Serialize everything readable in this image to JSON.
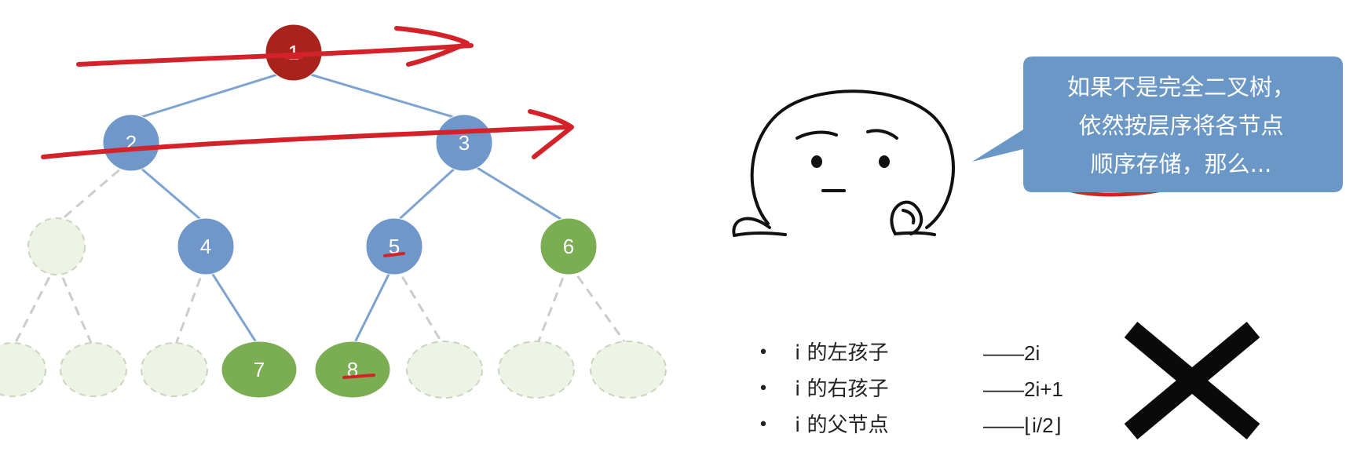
{
  "tree": {
    "nodes": [
      {
        "id": "1",
        "label": "1",
        "level": 0,
        "status": "root"
      },
      {
        "id": "2",
        "label": "2",
        "level": 1,
        "status": "stored"
      },
      {
        "id": "3",
        "label": "3",
        "level": 1,
        "status": "stored"
      },
      {
        "id": "g2l",
        "label": "",
        "level": 2,
        "status": "ghost"
      },
      {
        "id": "4",
        "label": "4",
        "level": 2,
        "status": "stored"
      },
      {
        "id": "5",
        "label": "5",
        "level": 2,
        "status": "stored"
      },
      {
        "id": "6",
        "label": "6",
        "level": 2,
        "status": "leaf"
      },
      {
        "id": "g1",
        "label": "",
        "level": 3,
        "status": "ghost"
      },
      {
        "id": "g2",
        "label": "",
        "level": 3,
        "status": "ghost"
      },
      {
        "id": "g3",
        "label": "",
        "level": 3,
        "status": "ghost"
      },
      {
        "id": "7",
        "label": "7",
        "level": 3,
        "status": "leaf"
      },
      {
        "id": "8",
        "label": "8",
        "level": 3,
        "status": "leaf"
      },
      {
        "id": "g4",
        "label": "",
        "level": 3,
        "status": "ghost"
      },
      {
        "id": "g5",
        "label": "",
        "level": 3,
        "status": "ghost"
      },
      {
        "id": "g6",
        "label": "",
        "level": 3,
        "status": "ghost"
      }
    ],
    "colors": {
      "root": "#a9231d",
      "stored": "#6f97c9",
      "leaf": "#7bae52",
      "ghost_fill": "#eef3e6",
      "ghost_stroke": "#c9d6bd",
      "edge": "#7fa3cf",
      "ghost_edge": "#cccccc",
      "annotation": "#d4222a"
    }
  },
  "speech_bubble": {
    "lines": [
      "如果不是完全二叉树，",
      "依然按层序将各节点",
      "顺序存储，那么..."
    ],
    "fill": "#6a97c6"
  },
  "formulas": [
    {
      "relation": "i 的左孩子",
      "value": "——2i"
    },
    {
      "relation": "i 的右孩子",
      "value": "——2i+1"
    },
    {
      "relation": "i 的父节点",
      "value": "——⌊i/2⌋"
    }
  ],
  "bullet": "•",
  "mark_icon": "cross-mark-icon"
}
